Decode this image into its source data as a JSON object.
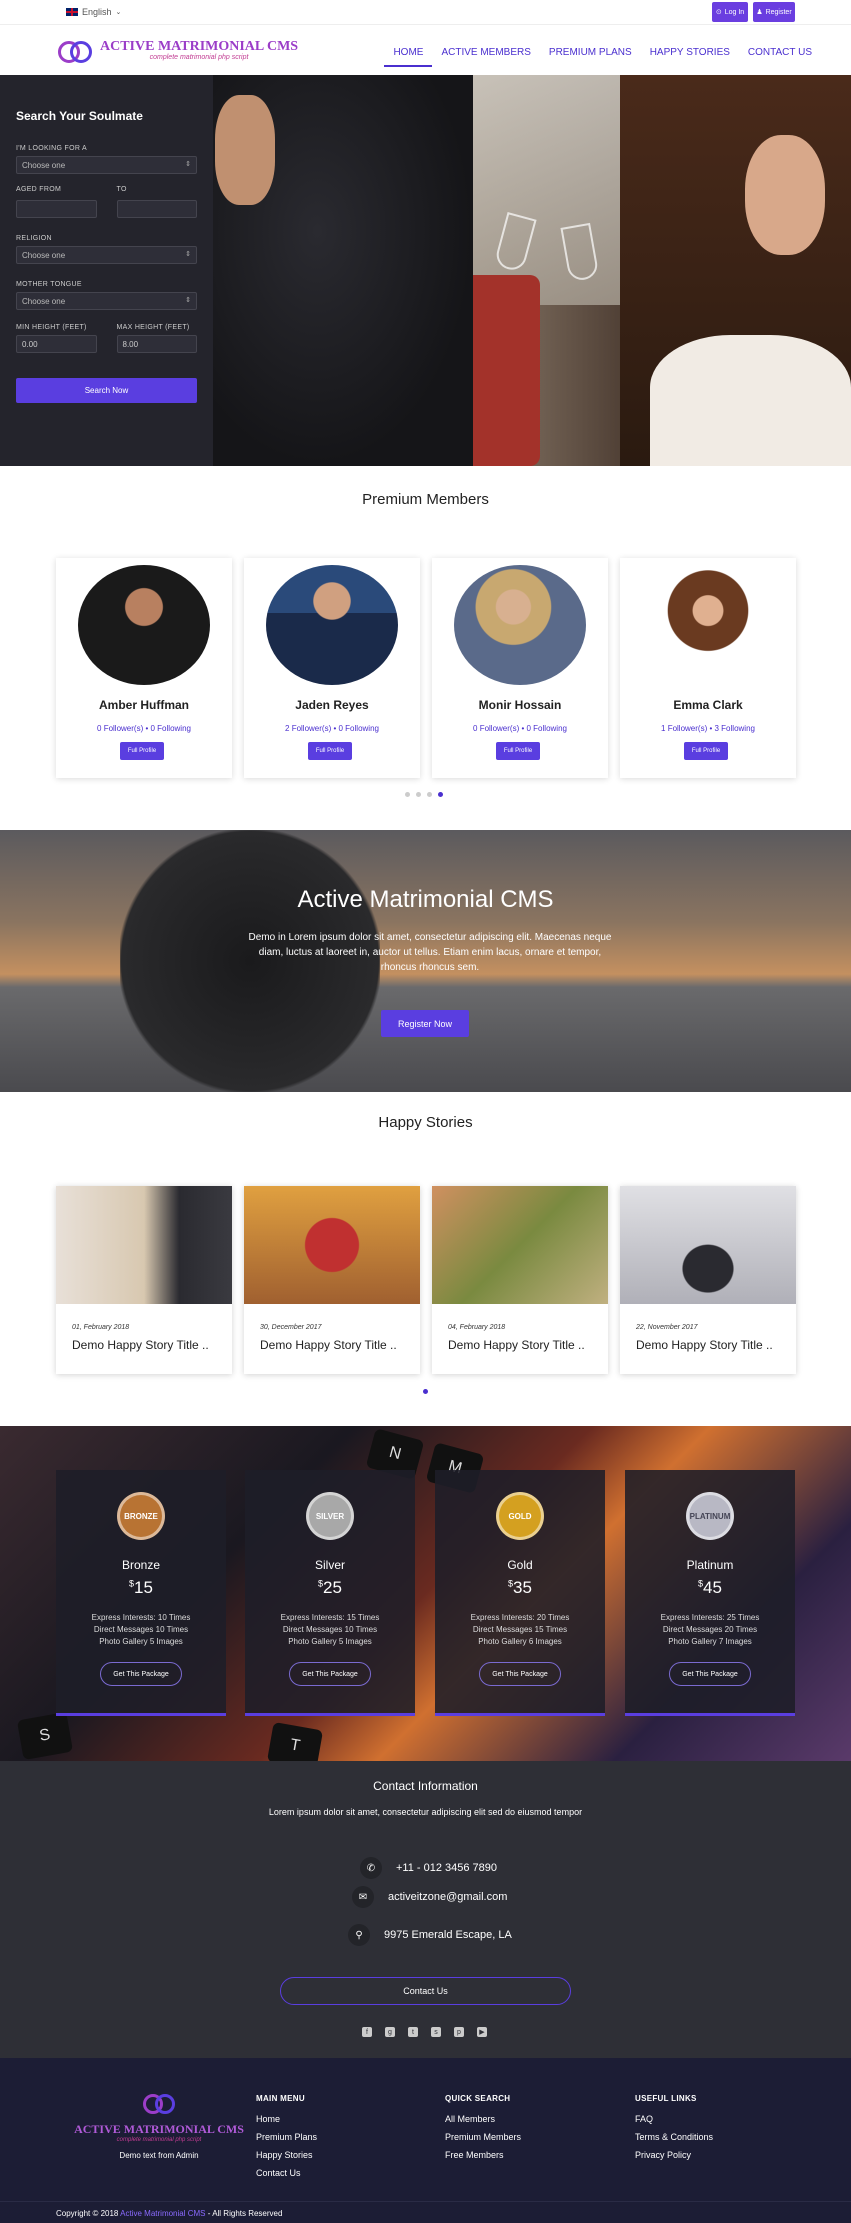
{
  "topbar": {
    "language": "English",
    "login": "Log In",
    "register": "Register"
  },
  "brand": {
    "name": "ACTIVE MATRIMONIAL CMS",
    "tagline": "complete matrimonial php script"
  },
  "nav": [
    "HOME",
    "ACTIVE MEMBERS",
    "PREMIUM PLANS",
    "HAPPY STORIES",
    "CONTACT US"
  ],
  "search": {
    "title": "Search Your Soulmate",
    "looking_label": "I'M LOOKING FOR A",
    "looking_value": "Choose one",
    "aged_from": "AGED FROM",
    "to": "TO",
    "religion_label": "RELIGION",
    "religion_value": "Choose one",
    "tongue_label": "MOTHER TONGUE",
    "tongue_value": "Choose one",
    "min_height_label": "MIN HEIGHT (FEET)",
    "min_height": "0.00",
    "max_height_label": "MAX HEIGHT (FEET)",
    "max_height": "8.00",
    "button": "Search Now"
  },
  "premium": {
    "title": "Premium Members",
    "members": [
      {
        "name": "Amber Huffman",
        "followers": "0 Follower(s)",
        "following": "0 Following",
        "button": "Full Profile"
      },
      {
        "name": "Jaden Reyes",
        "followers": "2 Follower(s)",
        "following": "0 Following",
        "button": "Full Profile"
      },
      {
        "name": "Monir Hossain",
        "followers": "0 Follower(s)",
        "following": "0 Following",
        "button": "Full Profile"
      },
      {
        "name": "Emma Clark",
        "followers": "1 Follower(s)",
        "following": "3 Following",
        "button": "Full Profile"
      }
    ]
  },
  "banner": {
    "title": "Active Matrimonial CMS",
    "text": "Demo in Lorem ipsum dolor sit amet, consectetur adipiscing elit. Maecenas neque diam, luctus at laoreet in, auctor ut tellus. Etiam enim lacus, ornare et tempor, rhoncus rhoncus sem.",
    "button": "Register Now"
  },
  "stories": {
    "title": "Happy Stories",
    "items": [
      {
        "date": "01, February 2018",
        "title": "Demo Happy Story Title .."
      },
      {
        "date": "30, December 2017",
        "title": "Demo Happy Story Title .."
      },
      {
        "date": "04, February 2018",
        "title": "Demo Happy Story Title .."
      },
      {
        "date": "22, November 2017",
        "title": "Demo Happy Story Title .."
      }
    ]
  },
  "plans": [
    {
      "medal": "BRONZE",
      "name": "Bronze",
      "currency": "$",
      "price": "15",
      "f1": "Express Interests: 10 Times",
      "f2": "Direct Messages 10 Times",
      "f3": "Photo Gallery 5 Images",
      "button": "Get This Package",
      "color": "#b87333"
    },
    {
      "medal": "SILVER",
      "name": "Silver",
      "currency": "$",
      "price": "25",
      "f1": "Express Interests: 15 Times",
      "f2": "Direct Messages 10 Times",
      "f3": "Photo Gallery 5 Images",
      "button": "Get This Package",
      "color": "#a8a8a8"
    },
    {
      "medal": "GOLD",
      "name": "Gold",
      "currency": "$",
      "price": "35",
      "f1": "Express Interests: 20 Times",
      "f2": "Direct Messages 15 Times",
      "f3": "Photo Gallery 6 Images",
      "button": "Get This Package",
      "color": "#d4a020"
    },
    {
      "medal": "PLATINUM",
      "name": "Platinum",
      "currency": "$",
      "price": "45",
      "f1": "Express Interests: 25 Times",
      "f2": "Direct Messages 20 Times",
      "f3": "Photo Gallery 7 Images",
      "button": "Get This Package",
      "color": "#c8c8d0"
    }
  ],
  "contact": {
    "title": "Contact Information",
    "text": "Lorem ipsum dolor sit amet, consectetur adipiscing elit sed do eiusmod tempor",
    "phone": "+11 - 012 3456 7890",
    "email": "activeitzone@gmail.com",
    "address": "9975 Emerald Escape, LA",
    "button": "Contact Us"
  },
  "footer": {
    "logo_text": "Demo text from Admin",
    "main_menu": {
      "title": "MAIN MENU",
      "links": [
        "Home",
        "Premium Plans",
        "Happy Stories",
        "Contact Us"
      ]
    },
    "quick": {
      "title": "QUICK SEARCH",
      "links": [
        "All Members",
        "Premium Members",
        "Free Members"
      ]
    },
    "useful": {
      "title": "USEFUL LINKS",
      "links": [
        "FAQ",
        "Terms & Conditions",
        "Privacy Policy"
      ]
    },
    "copyright_pre": "Copyright © 2018",
    "copyright_link": "Active Matrimonial CMS",
    "copyright_post": "- All Rights Reserved"
  }
}
